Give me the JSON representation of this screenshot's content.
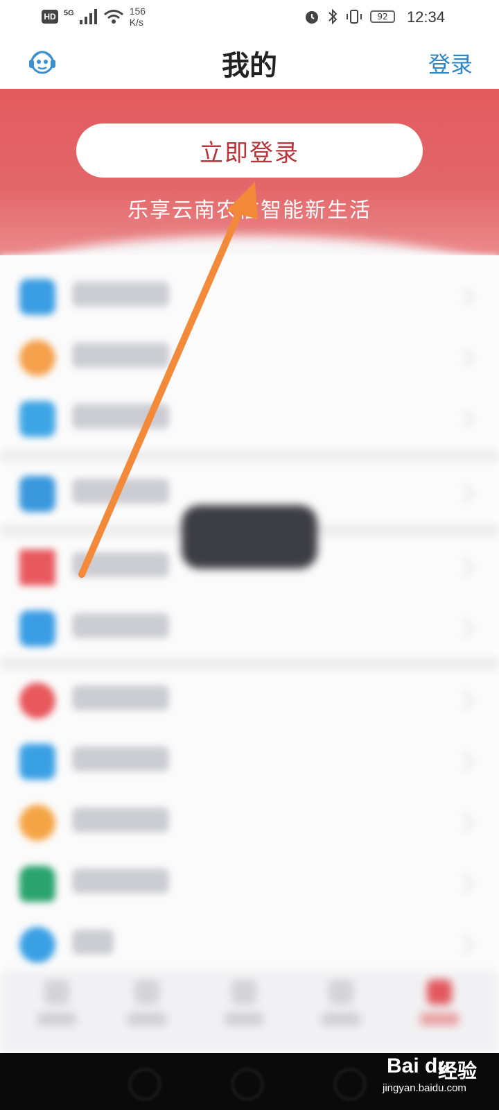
{
  "status_bar": {
    "hd": "HD",
    "network": "5G",
    "speed_value": "156",
    "speed_unit": "K/s",
    "battery": "92",
    "time": "12:34"
  },
  "app_bar": {
    "title": "我的",
    "login_link": "登录",
    "left_icon": "customer-service-icon"
  },
  "banner": {
    "login_button": "立即登录",
    "slogan": "乐享云南农信智能新生活"
  },
  "colors": {
    "banner_red": "#e25a5e",
    "login_text": "#b7343a",
    "link_blue": "#2f86c7",
    "arrow_orange": "#f28a3a"
  },
  "menu_icon_colors": [
    "#3b9de3",
    "#f5a04a",
    "#3ea6e6",
    "#3a98dd",
    "#e8595e",
    "#3a9de4",
    "#e8585c",
    "#3aa0e4",
    "#f5a445",
    "#2aa36e",
    "#3aa0e4"
  ],
  "watermark": {
    "logo": "Bai du",
    "cn": "经验",
    "site": "jingyan.baidu.com"
  }
}
